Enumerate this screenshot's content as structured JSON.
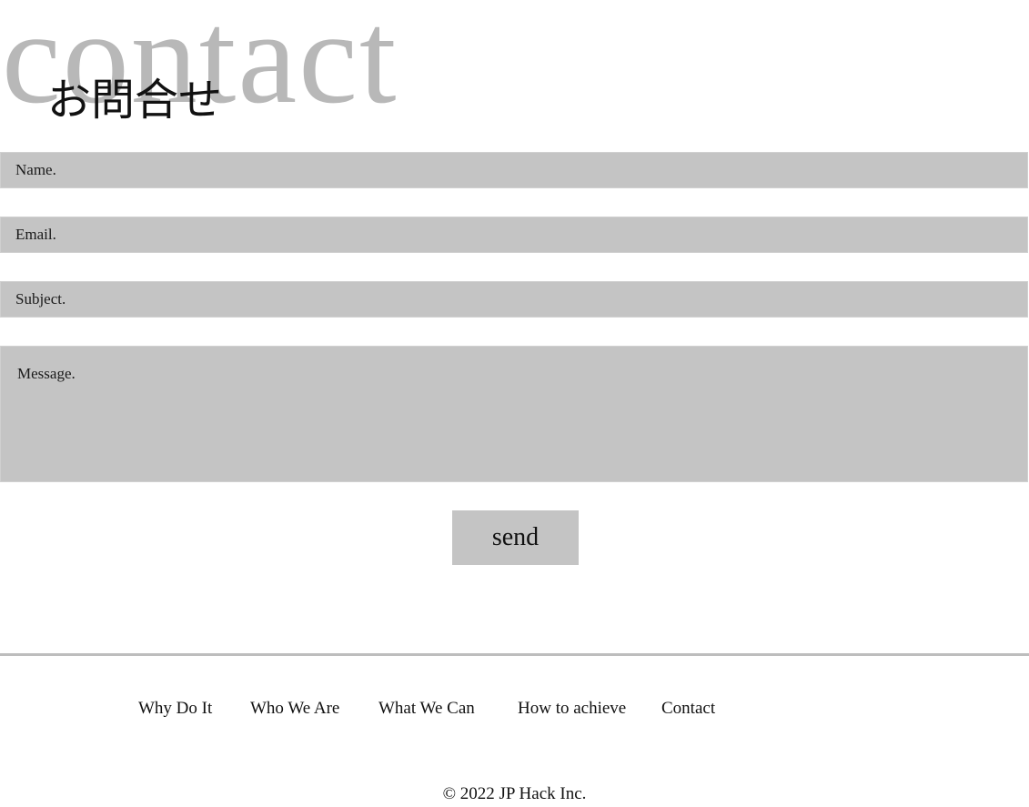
{
  "hero": {
    "background_word": "contact",
    "title": "お問合せ"
  },
  "form": {
    "name_placeholder": "Name.",
    "email_placeholder": "Email.",
    "subject_placeholder": "Subject.",
    "message_placeholder": "Message.",
    "send_label": "send"
  },
  "footer": {
    "nav": {
      "why": "Why Do It",
      "who": "Who We Are",
      "what": "What We Can",
      "how": "How to achieve",
      "contact": "Contact"
    },
    "copyright": "© 2022 JP Hack Inc."
  },
  "colors": {
    "field_background": "#c4c4c4",
    "hero_word": "#b8b8b8",
    "divider": "#bdbdbd"
  }
}
